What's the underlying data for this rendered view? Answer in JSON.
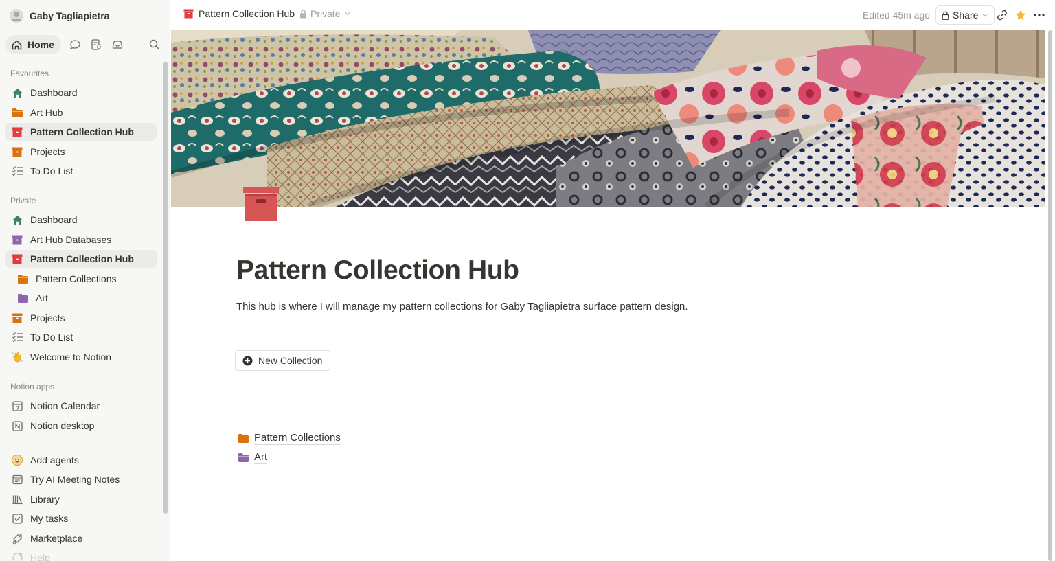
{
  "workspace": {
    "name": "Gaby Tagliapietra"
  },
  "sidebar_top": {
    "home_label": "Home"
  },
  "sections": {
    "favourites": "Favourites",
    "private": "Private",
    "notion_apps": "Notion apps"
  },
  "favourites": [
    {
      "label": "Dashboard",
      "icon": "house-icon"
    },
    {
      "label": "Art Hub",
      "icon": "folder-icon"
    },
    {
      "label": "Pattern Collection Hub",
      "icon": "archive-box-icon"
    },
    {
      "label": "Projects",
      "icon": "archive-box-icon"
    },
    {
      "label": "To Do List",
      "icon": "checklist-icon"
    }
  ],
  "private": [
    {
      "label": "Dashboard",
      "icon": "house-icon"
    },
    {
      "label": "Art Hub Databases",
      "icon": "archive-box-icon"
    },
    {
      "label": "Pattern Collection Hub",
      "icon": "archive-box-icon"
    },
    {
      "label": "Pattern Collections",
      "icon": "folder-icon"
    },
    {
      "label": "Art",
      "icon": "folder-icon"
    },
    {
      "label": "Projects",
      "icon": "archive-box-icon"
    },
    {
      "label": "To Do List",
      "icon": "checklist-icon"
    },
    {
      "label": "Welcome to Notion",
      "icon": "waving-hand-icon"
    }
  ],
  "notion_apps": [
    {
      "label": "Notion Calendar",
      "icon": "calendar-icon"
    },
    {
      "label": "Notion desktop",
      "icon": "notion-desktop-icon"
    }
  ],
  "extras": [
    {
      "label": "Add agents",
      "icon": "agent-face-icon"
    },
    {
      "label": "Try AI Meeting Notes",
      "icon": "meeting-notes-icon"
    },
    {
      "label": "Library",
      "icon": "library-icon"
    },
    {
      "label": "My tasks",
      "icon": "checkbox-icon"
    },
    {
      "label": "Marketplace",
      "icon": "marketplace-icon"
    },
    {
      "label": "Help",
      "icon": "help-icon"
    }
  ],
  "header": {
    "page_title": "Pattern Collection Hub",
    "privacy": "Private",
    "edited": "Edited 45m ago",
    "share_label": "Share"
  },
  "page": {
    "title": "Pattern Collection Hub",
    "description": "This hub is where I will manage my pattern collections for Gaby Tagliapietra surface pattern design.",
    "new_button": "New Collection",
    "subpages": [
      {
        "label": "Pattern Collections",
        "icon": "folder-icon",
        "color": "#d9730d"
      },
      {
        "label": "Art",
        "icon": "folder-icon",
        "color": "#9065b0"
      }
    ]
  },
  "colors": {
    "accent_red": "#e03e3e",
    "folder_orange": "#d9730d",
    "folder_purple": "#9065b0",
    "house_green": "#448361",
    "star_yellow": "#f5b82e"
  }
}
